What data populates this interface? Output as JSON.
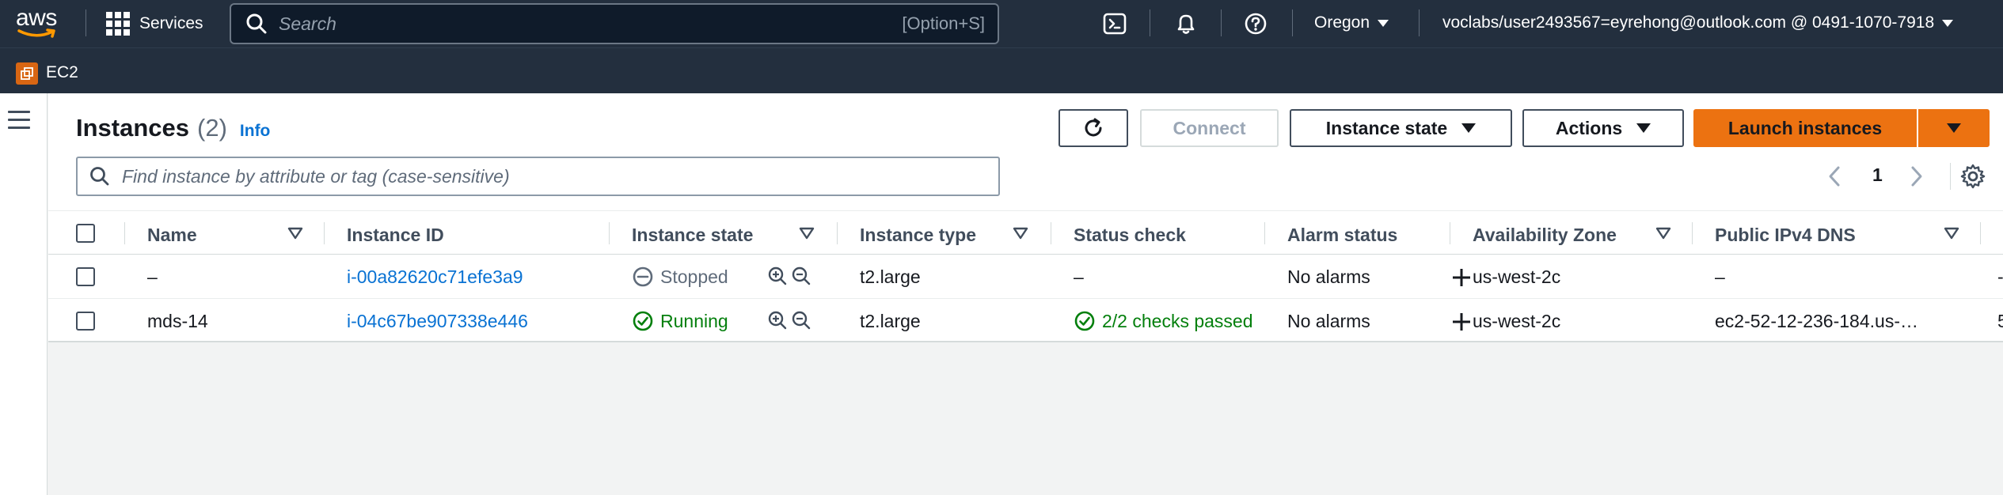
{
  "topnav": {
    "logo_text": "aws",
    "services_label": "Services",
    "search_placeholder": "Search",
    "search_shortcut": "[Option+S]",
    "region": "Oregon",
    "account": "voclabs/user2493567=eyrehong@outlook.com @ 0491-1070-7918",
    "icons": [
      "cloudshell-icon",
      "bell-icon",
      "help-icon"
    ]
  },
  "servicebar": {
    "service": "EC2"
  },
  "page": {
    "title": "Instances",
    "count": "(2)",
    "info": "Info",
    "buttons": {
      "refresh": "refresh-icon",
      "connect": "Connect",
      "instance_state": "Instance state",
      "actions": "Actions",
      "launch": "Launch instances"
    },
    "filter_placeholder": "Find instance by attribute or tag (case-sensitive)",
    "page_number": "1"
  },
  "table": {
    "columns": [
      "Name",
      "Instance ID",
      "Instance state",
      "Instance type",
      "Status check",
      "Alarm status",
      "Availability Zone",
      "Public IPv4 DNS"
    ],
    "rows": [
      {
        "name": "–",
        "instance_id": "i-00a82620c71efe3a9",
        "state": "Stopped",
        "type": "t2.large",
        "status_check": "–",
        "alarm": "No alarms",
        "az": "us-west-2c",
        "dns": "–",
        "overflow": "-"
      },
      {
        "name": "mds-14",
        "instance_id": "i-04c67be907338e446",
        "state": "Running",
        "type": "t2.large",
        "status_check": "2/2 checks passed",
        "alarm": "No alarms",
        "az": "us-west-2c",
        "dns": "ec2-52-12-236-184.us-…",
        "overflow": "5"
      }
    ]
  },
  "colors": {
    "nav_bg": "#232f3e",
    "accent_orange": "#ec7211",
    "link_blue": "#0972d3",
    "success_green": "#037f0c"
  }
}
